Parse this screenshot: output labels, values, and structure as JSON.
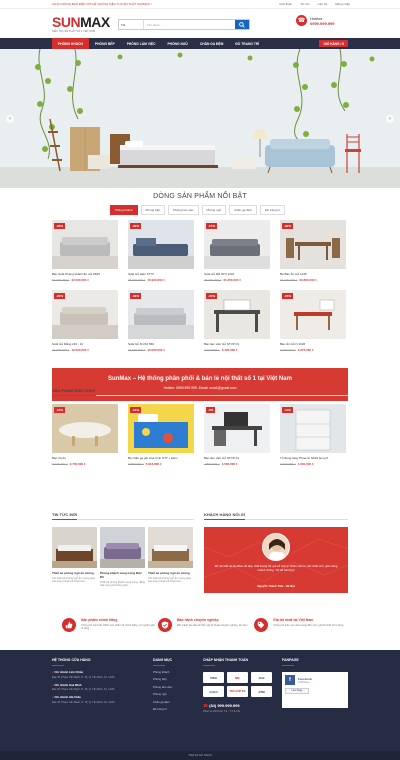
{
  "topbar": {
    "notice": "CHÀO MỪNG BẠN ĐẾN VỚI HỆ THỐNG SIÊU THỊ NỘI THẤT SUNMAX !",
    "links": [
      "Giới thiệu",
      "Tin tức",
      "Liên hệ",
      "Đăng nhập"
    ]
  },
  "header": {
    "brand_red": "SUN",
    "brand_dark": "MAX",
    "tagline": "SIÊU THỊ NỘI THẤT SỐ 1 VIỆT NAM",
    "search_select": "Tất",
    "search_placeholder": "Tìm kiếm...",
    "hotline_label": "Hotline",
    "hotline_number": "0999.999.999"
  },
  "nav": {
    "items": [
      "PHÒNG KHÁCH",
      "PHÒNG BẾP",
      "PHÒNG LÀM VIỆC",
      "PHÒNG NGỦ",
      "CHĂN GA ĐỆM",
      "ĐỒ TRANG TRÍ"
    ],
    "cart": "GIỎ HÀNG / 0"
  },
  "hero": {
    "prev": "‹",
    "next": "›"
  },
  "featured": {
    "title": "DÒNG SẢN PHẨM NỔI BẬT",
    "tabs": [
      "Phòng khách",
      "Phòng bếp",
      "Phòng làm việc",
      "Phòng ngủ",
      "Chăn ga đệm",
      "Đồ trang trí"
    ],
    "products": [
      {
        "badge": "-28%",
        "name": "Bàn Sofa Phòng khách ấu mẫ N625",
        "old": "57.000.000 ₫",
        "price": "42.000.000 ₫"
      },
      {
        "badge": "-39%",
        "name": "Sofa Gỗ Hiện F773",
        "old": "25.000.000 ₫",
        "price": "15.900.000 ₫"
      },
      {
        "badge": "-17%",
        "name": "Sofa Gỗ Mẫ NTV 1104",
        "old": "25.000.000 ₫",
        "price": "21.250.000 ₫"
      },
      {
        "badge": "-32%",
        "name": "Bộ Bàn Ăn Gỗ 1230",
        "old": "34.000.000 ₫",
        "price": "22.800.000 ₫"
      },
      {
        "badge": "-20%",
        "name": "Sofa Gỗ Mẫng 216 - 10",
        "old": "15.000.000 ₫",
        "price": "12.000.000 ₫"
      },
      {
        "badge": "-36%",
        "name": "Sofa Gỗ M 201 566",
        "old": "25.000.000 ₫",
        "price": "16.000.000 ₫"
      },
      {
        "badge": "-15%",
        "name": "Bàn làm việc Gỗ NTVP 01",
        "old": "4.000.000 ₫",
        "price": "3.400.000 ₫"
      },
      {
        "badge": "-15%",
        "name": "Bàn Ăn Gỗ N 1026",
        "old": "7.500.000 ₫",
        "price": "6.375.000 ₫"
      }
    ]
  },
  "banner": {
    "title": "SunMax – Hệ thống phân phối & bán lẻ nội thất số 1 tại Việt Nam",
    "contact": "Hotline: 0999.999.999 -Email: sma1@gmail.com"
  },
  "bestsellers": {
    "title": "SẢN PHẨM BÁN CHẠY",
    "products": [
      {
        "badge": "-13%",
        "name": "Bàn trà 01",
        "old": "3.100.000 ₫",
        "price": "2.700.000 ₫"
      },
      {
        "badge": "-14%",
        "name": "Bộ chăn ga gối Hoa Xinh NTT + Đệm",
        "old": "6.880.000 ₫",
        "price": "5.916.800 ₫"
      },
      {
        "badge": "-6%",
        "name": "Bàn làm việc Gỗ NTVP 01",
        "old": "4.800.000 ₫",
        "price": "4.500.000 ₫"
      },
      {
        "badge": "-11%",
        "name": "Tủ đựng Giày Phoenix N634 bung 5",
        "old": "4.500.000 ₫",
        "price": "4.000.000 ₫"
      }
    ]
  },
  "news": {
    "title": "TIN TỨC MỚI",
    "items": [
      {
        "title": "Thiết kế phòng ngủ ấn tượng",
        "desc": "Với thiết kế phòng ngủ ấn tượng giúp bạn sảng khoái và thoải mái..."
      },
      {
        "title": "Phòng khách sang trọng Đức Đồ",
        "desc": "Thiết kế phòng khách sang trọng, đẳng cấp mang lại không gian..."
      },
      {
        "title": "Thiết kế phòng ngủ ấn tượng",
        "desc": "Với thiết kế phòng ngủ ấn tượng giúp bạn sảng khoái và thoải mái..."
      }
    ]
  },
  "testimonial": {
    "title": "KHÁCH HÀNG NÓI GÌ",
    "quote": "Đồ nội thất tại SunMax rất đẹp, chất lượng tốt, giá cả hợp lý. Nhân viên tư vấn nhiệt tình, giao hàng nhanh chóng. Tôi rất hài lòng!",
    "author": "Nguyễn Thanh Tâm - Hà Nội"
  },
  "features": [
    {
      "title": "Sản phẩm chính hãng",
      "desc": "Chúng tôi cam kết 100% sản phẩm là chính hãng, có nguồn gốc rõ ràng"
    },
    {
      "title": "Bảo hành chuyên nghiệp",
      "desc": "Bảo hành lâu dài với đội ngũ kỹ thuật chuyên nghiệp, tận tâm"
    },
    {
      "title": "Giá tốt nhất tại Việt Nam",
      "desc": "Chúng tôi luôn cam kết mang đến mức giá tốt nhất thị trường"
    }
  ],
  "footer": {
    "stores_title": "HỆ THỐNG CỬA HÀNG",
    "stores": [
      {
        "name": "Chi nhánh Liên Chiểu",
        "addr": "Địa chỉ: Phạm Văn Bạch, P. 15, Q. Tân Bình, Tp. HCM"
      },
      {
        "name": "Chi nhánh Hoà Minh",
        "addr": "Địa chỉ: Phạm Văn Bạch, P. 15, Q. Tân Bình, Tp. HCM"
      },
      {
        "name": "Chi nhánh Hải Châu",
        "addr": "Địa chỉ: Phạm Văn Bạch, P. 15, Q. Tân Bình, Tp. HCM"
      }
    ],
    "category_title": "DANH MỤC",
    "categories": [
      "Phòng khách",
      "Phòng bếp",
      "Phòng làm việc",
      "Phòng ngủ",
      "Chăn ga đệm",
      "Đồ trang trí"
    ],
    "payment_title": "CHẤP NHẬN THANH TOÁN",
    "payments": [
      "VISA",
      "MC",
      "JCB",
      "AMEX",
      "TRẢ GÓP 0%",
      "ATM"
    ],
    "phone": "(84) 999.999.999",
    "hours": "Phục vụ 24/7/Lúc T.2 - T.7 & CN",
    "fanpage_title": "FANPAGE",
    "fb_name": "Facebook",
    "fb_likes": "2.5M likes",
    "fb_like_btn": "Like Page",
    "copyright": "Thiết kế bởi SAGO"
  }
}
